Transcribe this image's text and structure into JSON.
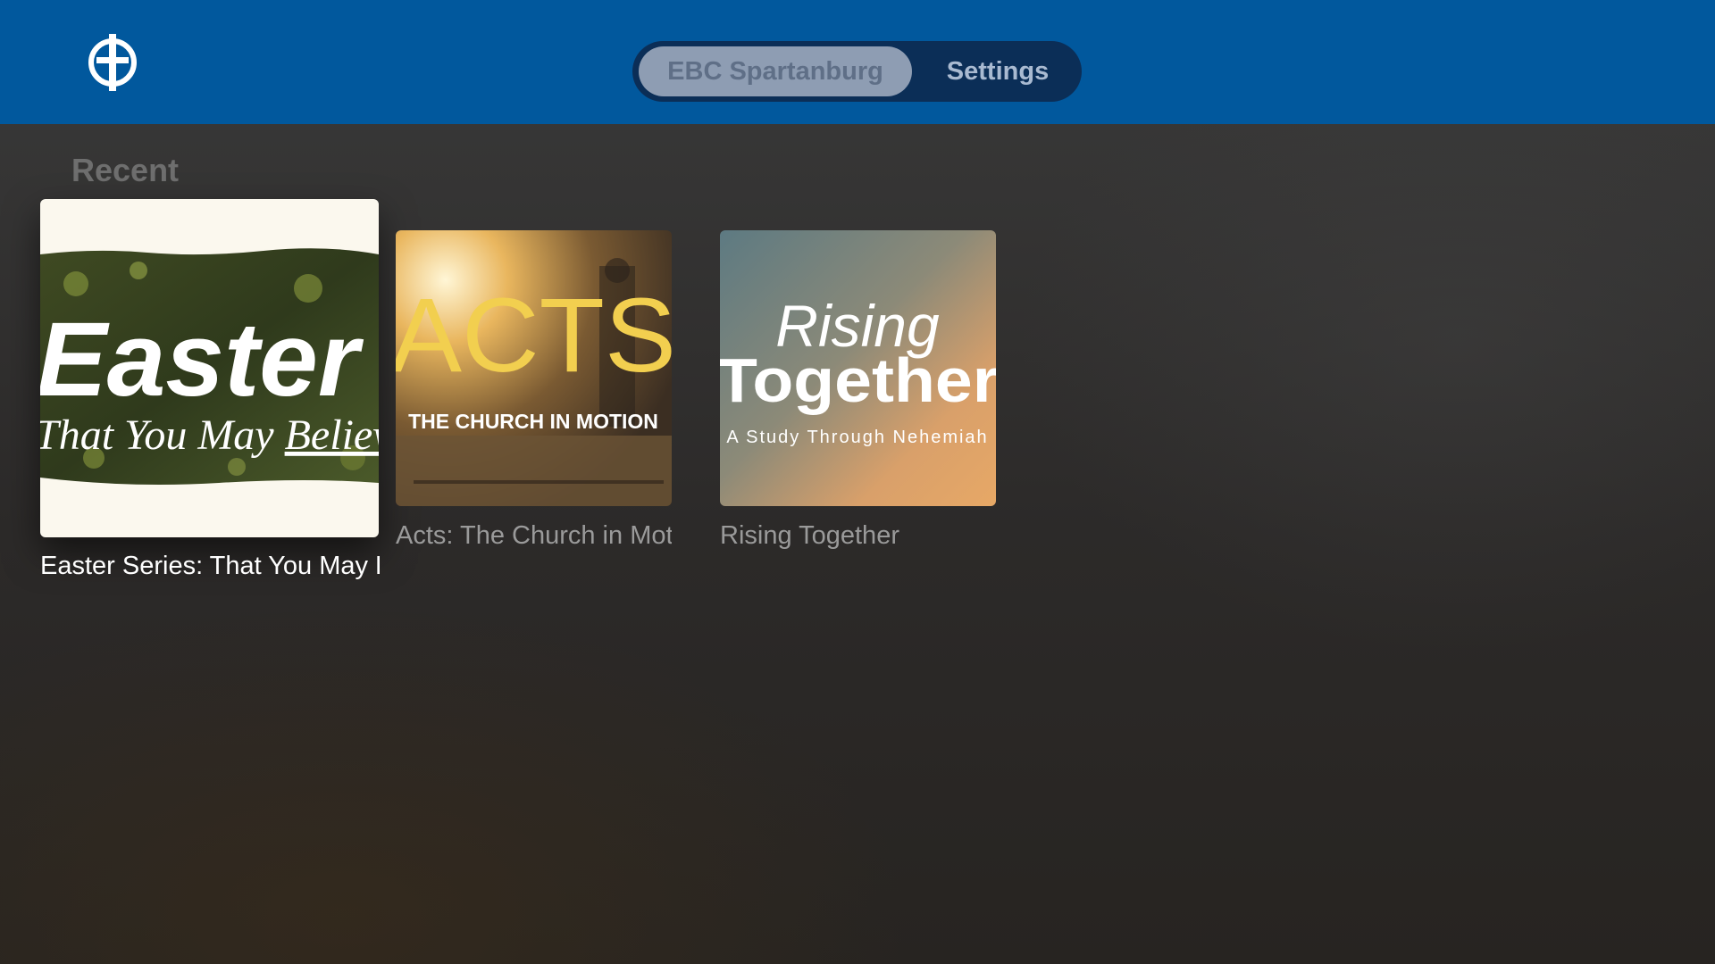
{
  "header": {
    "logo_icon": "church-cross-logo",
    "tabs": [
      {
        "label": "EBC Spartanburg",
        "selected": true
      },
      {
        "label": "Settings",
        "selected": false
      }
    ]
  },
  "recent": {
    "title": "Recent",
    "items": [
      {
        "label": "Easter Series: That You May Believe",
        "art_line1": "Easter",
        "art_line2": "That You May ",
        "art_line2_underlined": "Believe",
        "focused": true
      },
      {
        "label": "Acts: The Church in Motion",
        "art_title": "ACTS",
        "art_subtitle": "THE CHURCH IN MOTION",
        "focused": false
      },
      {
        "label": "Rising Together",
        "art_line1": "Rising",
        "art_line2": "Together",
        "art_subtitle": "A Study Through Nehemiah",
        "focused": false
      }
    ]
  },
  "colors": {
    "header_bg": "#01589d",
    "tabbar_bg": "#0b2e57",
    "tab_selected_bg": "#8e9db3"
  }
}
